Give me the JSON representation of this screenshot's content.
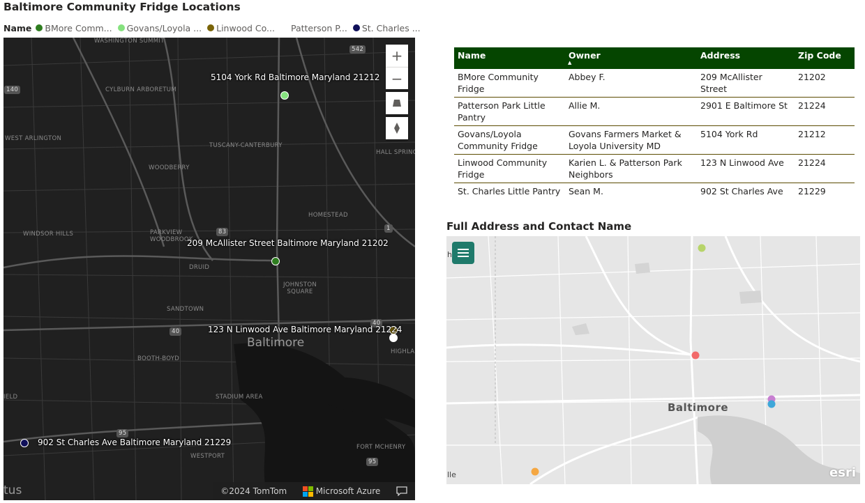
{
  "report": {
    "title": "Baltimore Community Fridge Locations"
  },
  "legend": {
    "label": "Name",
    "items": [
      {
        "text": "BMore Comm...",
        "color": "#2e7d1f"
      },
      {
        "text": "Govans/Loyola ...",
        "color": "#86e27f"
      },
      {
        "text": "Linwood Co...",
        "color": "#7a6408"
      },
      {
        "text": "Patterson P...",
        "color": "#ffffff"
      },
      {
        "text": "St. Charles ...",
        "color": "#10105a"
      }
    ]
  },
  "dark_map": {
    "pins": [
      {
        "label": "5104 York Rd Baltimore Maryland 21212",
        "color": "#86e27f"
      },
      {
        "label": "209 McAllister Street Baltimore Maryland 21202",
        "color": "#2e7d1f"
      },
      {
        "label": "123 N Linwood Ave Baltimore Maryland 21224",
        "color": "#7a6408"
      },
      {
        "label": "",
        "color": "#ffffff"
      },
      {
        "label": "902 St Charles Ave Baltimore Maryland 21229",
        "color": "#10105a"
      }
    ],
    "places": {
      "washington_summit": "WASHINGTON SUMMIT",
      "cylburn": "CYLBURN ARBORETUM",
      "west_arlington": "WEST ARLINGTON",
      "tuscany": "TUSCANY-CANTERBURY",
      "woodberry": "WOODBERRY",
      "hall_spring": "HALL SPRING",
      "homestead": "HOMESTEAD",
      "windsor_hills": "WINDSOR HILLS",
      "parkview": "PARKVIEW WOODBROOK",
      "druid": "DRUID",
      "johnston": "JOHNSTON SQUARE",
      "sandtown": "SANDTOWN",
      "booth_boyd": "BOOTH-BOYD",
      "highla": "HIGHLA",
      "stadium": "STADIUM AREA",
      "ield": "IELD",
      "westport": "WESTPORT",
      "fort": "FORT MCHENRY",
      "city": "Baltimore",
      "tus": "tus"
    },
    "shields": [
      "542",
      "140",
      "83",
      "1",
      "40",
      "40",
      "95",
      "95"
    ],
    "attribution": {
      "tomtom": "©2024 TomTom",
      "azure": "Microsoft Azure"
    },
    "controls": {
      "zoom_in": "+",
      "zoom_out": "−"
    }
  },
  "table": {
    "headers": [
      "Name",
      "Owner",
      "Address",
      "Zip Code"
    ],
    "sort_indicator": "▲",
    "rows": [
      [
        "BMore Community Fridge",
        "Abbey F.",
        "209 McAllister Street",
        "21202"
      ],
      [
        "Patterson Park Little Pantry",
        "Allie M.",
        "2901 E Baltimore St",
        "21224"
      ],
      [
        "Govans/Loyola Community Fridge",
        "Govans Farmers Market & Loyola University MD",
        "5104 York Rd",
        "21212"
      ],
      [
        "Linwood Community Fridge",
        "Karien L. & Patterson Park Neighbors",
        "123 N Linwood Ave",
        "21224"
      ],
      [
        "St. Charles Little Pantry",
        "Sean M.",
        "902 St Charles Ave",
        "21229"
      ]
    ]
  },
  "light_map": {
    "title": "Full Address and Contact Name",
    "city": "Baltimore",
    "edge_left_top": "h",
    "edge_left_bottom": "lle",
    "powered": "esri",
    "menu_icon": "hamburger-menu-icon",
    "pin_colors": [
      "#b7d46a",
      "#f26b6b",
      "#c77fd1",
      "#3fa7d9",
      "#f5a742"
    ]
  }
}
